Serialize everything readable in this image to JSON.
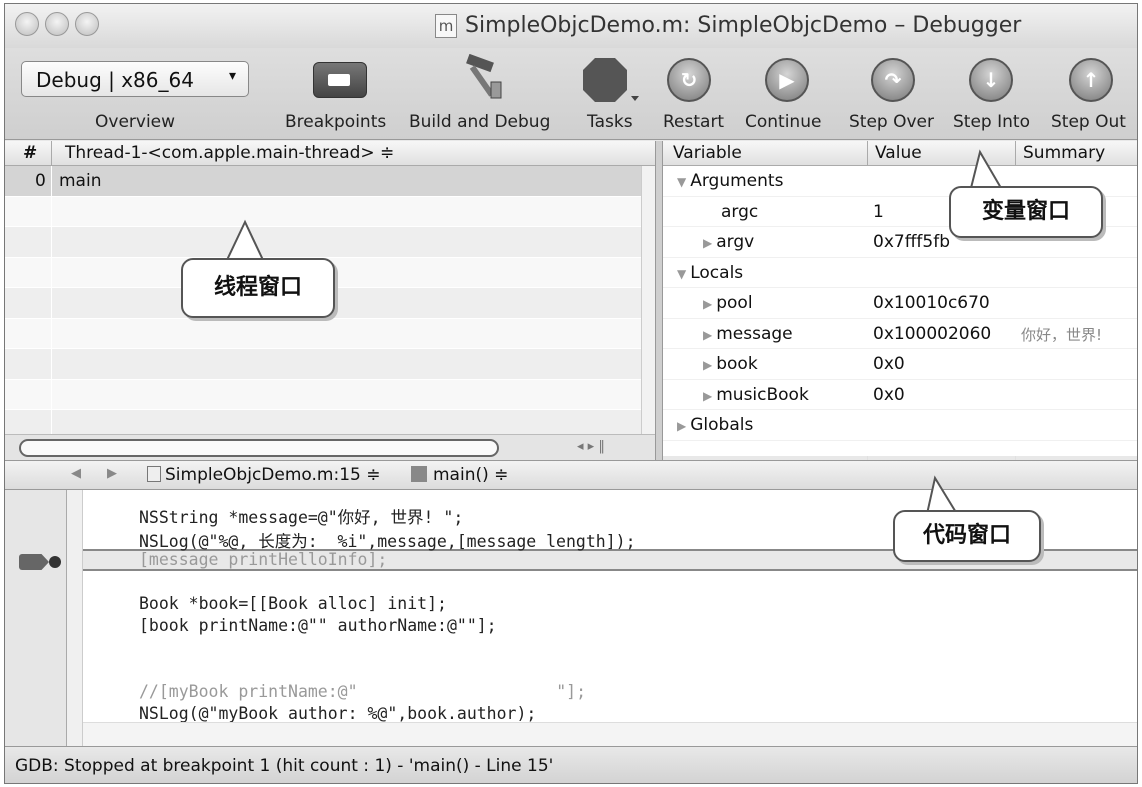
{
  "window": {
    "title": "SimpleObjcDemo.m: SimpleObjcDemo – Debugger",
    "doc_icon": "m"
  },
  "toolbar": {
    "scheme_value": "Debug | x86_64",
    "buttons": {
      "overview": "Overview",
      "breakpoints": "Breakpoints",
      "build_and_debug": "Build and Debug",
      "tasks": "Tasks",
      "restart": "Restart",
      "continue": "Continue",
      "step_over": "Step Over",
      "step_into": "Step Into",
      "step_out": "Step Out"
    }
  },
  "thread_pane": {
    "col_hash": "#",
    "col_thread": "Thread-1-<com.apple.main-thread> ≑",
    "rows": [
      {
        "idx": "0",
        "fn": "main"
      }
    ]
  },
  "variable_pane": {
    "headers": {
      "variable": "Variable",
      "value": "Value",
      "summary": "Summary"
    },
    "rows": [
      {
        "name": "Arguments",
        "value": "",
        "summary": "",
        "group": true
      },
      {
        "name": "argc",
        "value": "1",
        "summary": ""
      },
      {
        "name": "argv",
        "value": "0x7fff5fb",
        "summary": ""
      },
      {
        "name": "Locals",
        "value": "",
        "summary": "",
        "group": true
      },
      {
        "name": "pool",
        "value": "0x10010c670",
        "summary": ""
      },
      {
        "name": "message",
        "value": "0x100002060",
        "summary": "你好，世界!"
      },
      {
        "name": "book",
        "value": "0x0",
        "summary": ""
      },
      {
        "name": "musicBook",
        "value": "0x0",
        "summary": ""
      },
      {
        "name": "Globals",
        "value": "",
        "summary": "",
        "group": true
      }
    ]
  },
  "editor_nav": {
    "file": "SimpleObjcDemo.m:15 ≑",
    "function": "main() ≑"
  },
  "code_lines": [
    "NSString *message=@\"你好, 世界! \";",
    "NSLog(@\"%@, 长度为:  %i\",message,[message length]);",
    "[message printHelloInfo];",
    "Book *book=[[Book alloc] init];",
    "[book printName:@\"\" authorName:@\"\"];",
    "//[myBook printName:@\"                    \"];",
    "NSLog(@\"myBook author: %@\",book.author);"
  ],
  "status": "GDB: Stopped at breakpoint 1 (hit count : 1) - 'main() - Line 15'",
  "callouts": {
    "variable_window": "变量窗口",
    "thread_window": "线程窗口",
    "code_window": "代码窗口"
  }
}
